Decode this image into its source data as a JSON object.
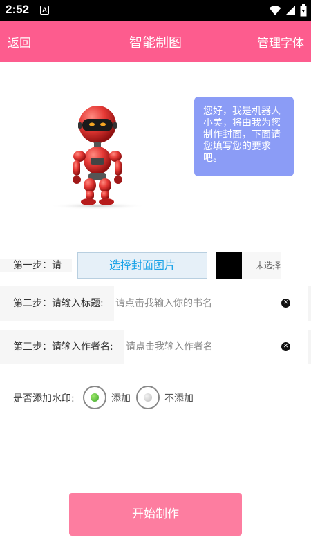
{
  "status_bar": {
    "time": "2:52",
    "badge": "A",
    "icons": [
      "wifi-icon",
      "signal-icon",
      "battery-icon"
    ]
  },
  "header": {
    "back_label": "返回",
    "title": "智能制图",
    "manage_font_label": "管理字体",
    "color": "#fd5c8e"
  },
  "bubble": {
    "text": "您好，我是机器人小美，将由我为您制作封面，下面请您填写您的要求吧。",
    "color": "#8b9cf6"
  },
  "step1": {
    "label": "第一步：请",
    "choose_button": "选择封面图片",
    "swatch_color": "#000000",
    "status": "未选择"
  },
  "step2": {
    "label": "第二步：请输入标题:",
    "value": "",
    "placeholder": "请点击我输入你的书名"
  },
  "step3": {
    "label": "第三步：请输入作者名:",
    "value": "",
    "placeholder": "请点击我输入作者名"
  },
  "watermark": {
    "label": "是否添加水印:",
    "options": [
      {
        "label": "添加",
        "selected": true
      },
      {
        "label": "不添加",
        "selected": false
      }
    ]
  },
  "start_button": {
    "label": "开始制作",
    "color": "#fd7da0"
  }
}
